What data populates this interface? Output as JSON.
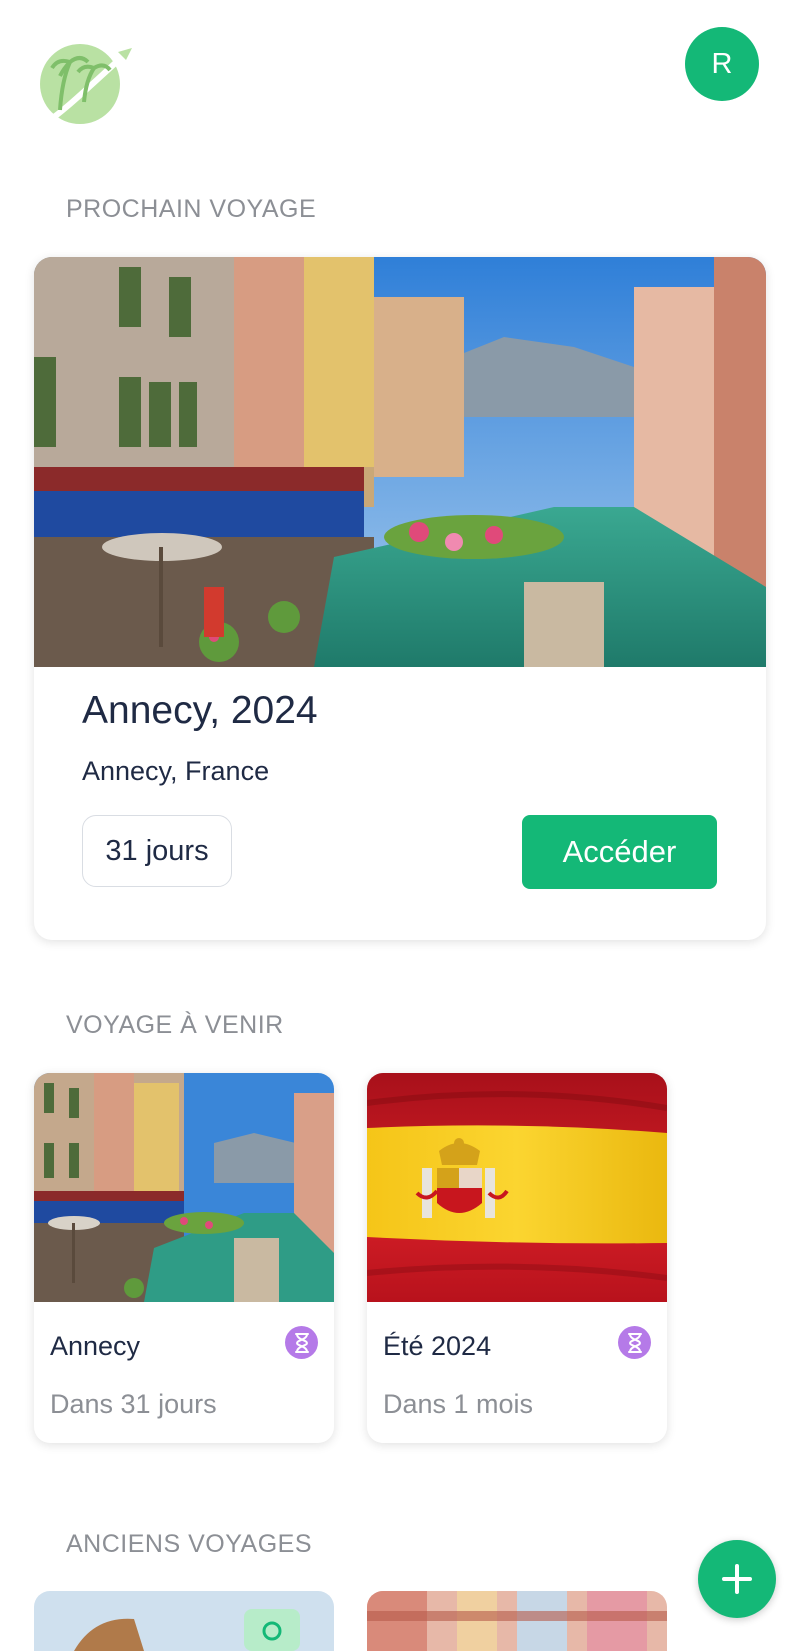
{
  "header": {
    "avatar_initial": "R"
  },
  "sections": {
    "next_trip": "PROCHAIN VOYAGE",
    "upcoming": "VOYAGE À VENIR",
    "past": "ANCIENS VOYAGES"
  },
  "hero": {
    "title": "Annecy, 2024",
    "location": "Annecy, France",
    "days_badge": "31 jours",
    "access_button": "Accéder"
  },
  "upcoming_trips": [
    {
      "name": "Annecy",
      "when": "Dans 31 jours",
      "status_icon": "hourglass-icon"
    },
    {
      "name": "Été 2024",
      "when": "Dans 1 mois",
      "status_icon": "hourglass-icon"
    }
  ],
  "colors": {
    "accent": "#14b877",
    "status": "#b57ae8",
    "muted": "#8c8f95",
    "text": "#1f2a44"
  }
}
